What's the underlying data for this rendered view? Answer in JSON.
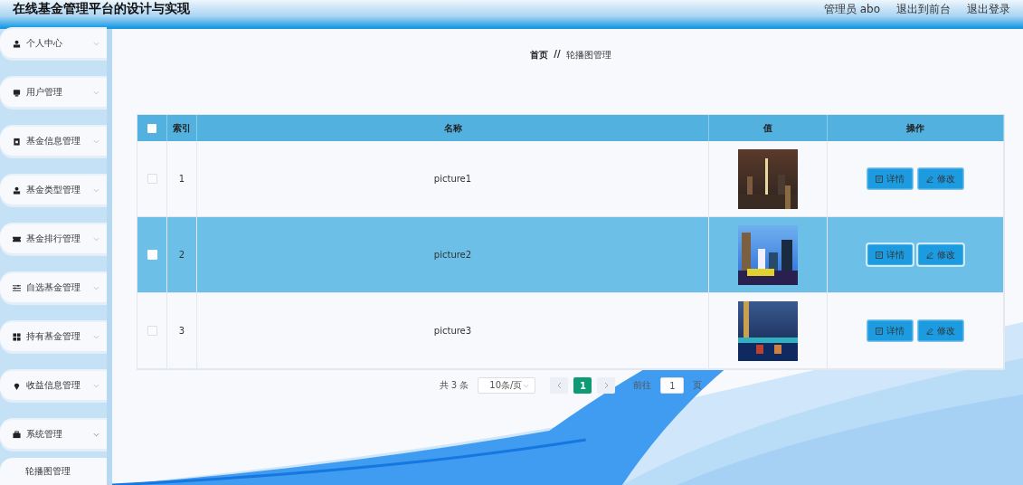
{
  "header": {
    "title": "在线基金管理平台的设计与实现",
    "user": "管理员 abo",
    "links": [
      "退出到前台",
      "退出登录"
    ]
  },
  "sidebar": {
    "items": [
      {
        "label": "个人中心",
        "expanded": false
      },
      {
        "label": "用户管理",
        "expanded": false
      },
      {
        "label": "基金信息管理",
        "expanded": false
      },
      {
        "label": "基金类型管理",
        "expanded": false
      },
      {
        "label": "基金排行管理",
        "expanded": false
      },
      {
        "label": "自选基金管理",
        "expanded": false
      },
      {
        "label": "持有基金管理",
        "expanded": false
      },
      {
        "label": "收益信息管理",
        "expanded": false
      },
      {
        "label": "系统管理",
        "expanded": true,
        "children": [
          {
            "label": "轮播图管理"
          }
        ]
      }
    ]
  },
  "breadcrumb": {
    "home": "首页",
    "separator": "//",
    "current": "轮播图管理"
  },
  "table": {
    "select_all_checked": false,
    "columns": [
      "索引",
      "名称",
      "值",
      "操作"
    ],
    "rows": [
      {
        "index": "1",
        "name": "picture1",
        "value": {
          "kind": "picture"
        },
        "highlighted": false,
        "checked": false,
        "actions": [
          "详情",
          "修改"
        ]
      },
      {
        "index": "2",
        "name": "picture2",
        "value": {
          "kind": "picture"
        },
        "highlighted": true,
        "checked": false,
        "actions": [
          "详情",
          "修改"
        ]
      },
      {
        "index": "3",
        "name": "picture3",
        "value": {
          "kind": "picture"
        },
        "highlighted": false,
        "checked": false,
        "actions": [
          "详情",
          "修改"
        ]
      }
    ]
  },
  "pagination": {
    "total": "共 3 条",
    "page_size": "10条/页",
    "pages": [
      {
        "label": "1",
        "selected": true
      }
    ],
    "goto_label": "前往",
    "goto_value": "1",
    "goto_suffix": "页"
  }
}
